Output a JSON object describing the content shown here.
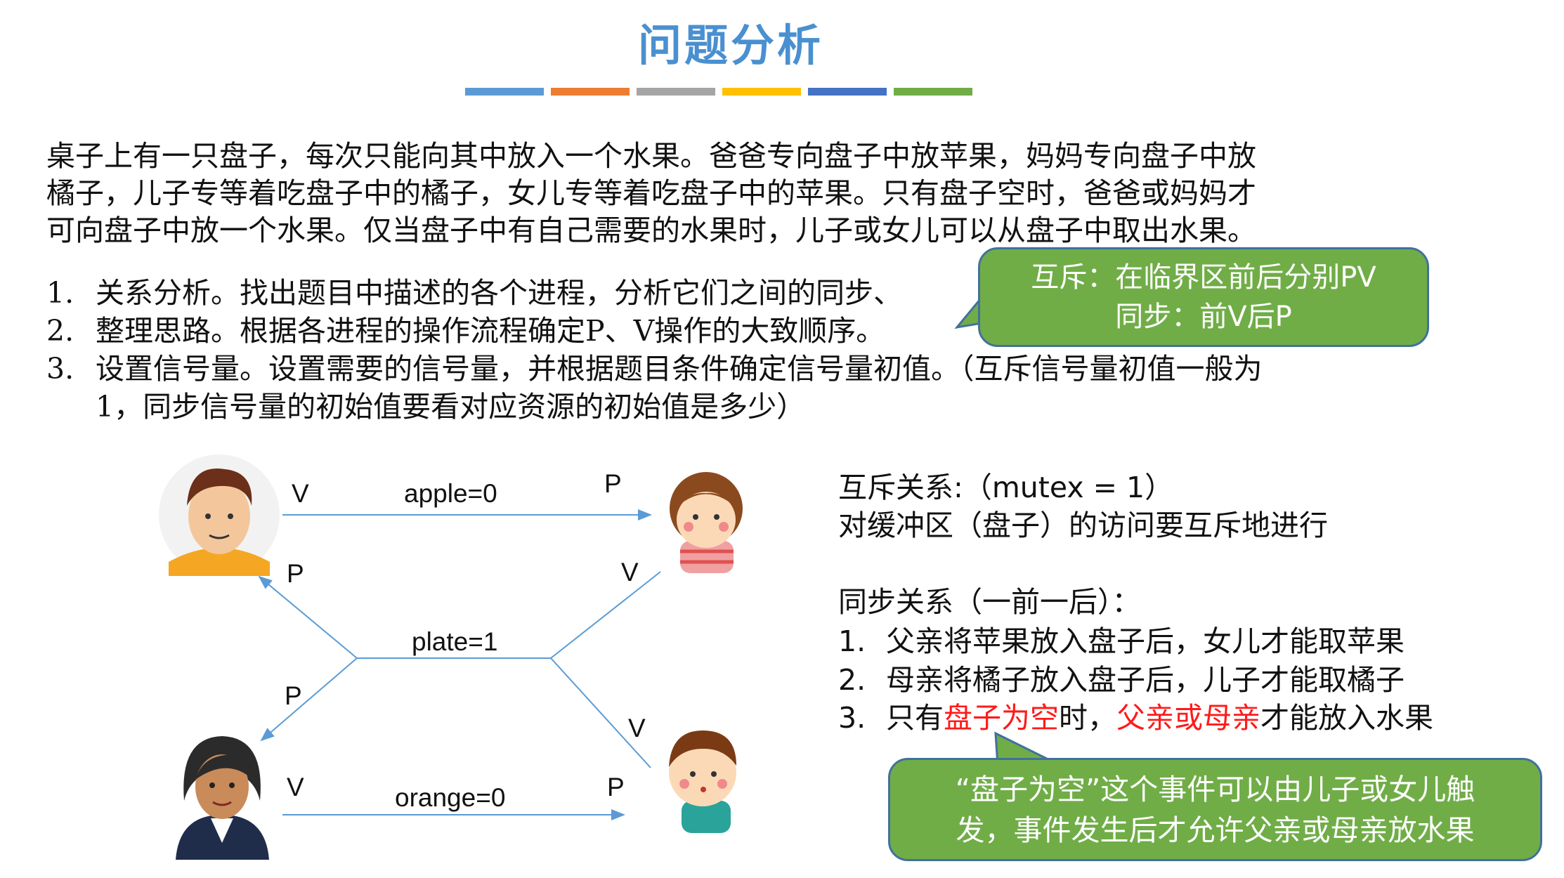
{
  "title": "问题分析",
  "color_bars": [
    "#5b9bd5",
    "#ed7d31",
    "#a5a5a5",
    "#ffc000",
    "#4472c4",
    "#70ad47"
  ],
  "problem": [
    "桌子上有一只盘子，每次只能向其中放入一个水果。爸爸专向盘子中放苹果，妈妈专向盘子中放",
    "橘子，儿子专等着吃盘子中的橘子，女儿专等着吃盘子中的苹果。只有盘子空时，爸爸或妈妈才",
    "可向盘子中放一个水果。仅当盘子中有自己需要的水果时，儿子或女儿可以从盘子中取出水果。"
  ],
  "steps": [
    {
      "num": "1.",
      "text": "关系分析。找出题目中描述的各个进程，分析它们之间的同步、"
    },
    {
      "num": "2.",
      "text": "整理思路。根据各进程的操作流程确定P、V操作的大致顺序。"
    },
    {
      "num": "3.",
      "text": "设置信号量。设置需要的信号量，并根据题目条件确定信号量初值。（互斥信号量初值一般为"
    },
    {
      "num": "",
      "text": "1，同步信号量的初始值要看对应资源的初始值是多少）"
    }
  ],
  "callout1": {
    "line1": "互斥：在临界区前后分别PV",
    "line2": "同步：前V后P"
  },
  "diagram": {
    "apple": "apple=0",
    "plate": "plate=1",
    "orange": "orange=0",
    "v": "V",
    "p": "P"
  },
  "right": {
    "mutex_title": "互斥关系:（mutex = 1）",
    "mutex_desc": "对缓冲区（盘子）的访问要互斥地进行",
    "sync_title": "同步关系（一前一后）：",
    "sync1_num": "1.",
    "sync1": "父亲将苹果放入盘子后，女儿才能取苹果",
    "sync2_num": "2.",
    "sync2": "母亲将橘子放入盘子后，儿子才能取橘子",
    "sync3_num": "3.",
    "sync3_a": "只有",
    "sync3_b": "盘子为空",
    "sync3_c": "时，",
    "sync3_d": "父亲或母亲",
    "sync3_e": "才能放入水果"
  },
  "callout2": {
    "line1": "“盘子为空”这个事件可以由儿子或女儿触",
    "line2": "发，事件发生后才允许父亲或母亲放水果"
  },
  "colors": {
    "accent": "#4a90d0",
    "callout": "#70ad47",
    "callout_border": "#41719c",
    "highlight": "#ff1a1a",
    "arrow": "#5b9bd5"
  }
}
